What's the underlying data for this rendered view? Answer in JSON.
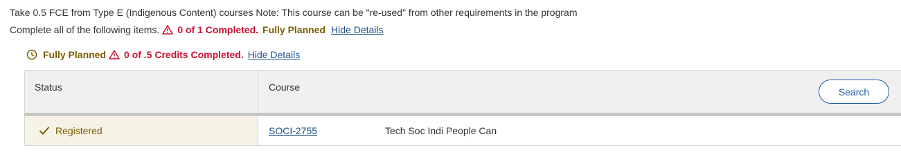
{
  "requirement": {
    "description": "Take 0.5 FCE from Type E (Indigenous Content) courses Note: This course can be \"re-used\" from other requirements in the program",
    "complete_prompt": "Complete all of the following items.",
    "completed_status": "0 of 1 Completed.",
    "planned_status": "Fully Planned",
    "toggle_details": "Hide Details"
  },
  "group": {
    "planned_status": "Fully Planned",
    "credits_status": "0 of .5 Credits Completed.",
    "toggle_details": "Hide Details"
  },
  "table": {
    "headers": {
      "status": "Status",
      "course": "Course"
    },
    "search_label": "Search",
    "rows": [
      {
        "status": "Registered",
        "course_code": "SOCI-2755",
        "course_title": "Tech Soc Indi People Can"
      }
    ]
  },
  "icons": {
    "warning": "warning-triangle-icon",
    "clock": "clock-icon",
    "check": "checkmark-icon"
  },
  "colors": {
    "warning_red": "#c8102e",
    "planned_gold": "#7a5c00",
    "link_blue": "#1a4f8a",
    "button_blue": "#1a5ca8",
    "status_cell_bg": "#f6f3e6",
    "header_bg": "#f0f0f0"
  }
}
